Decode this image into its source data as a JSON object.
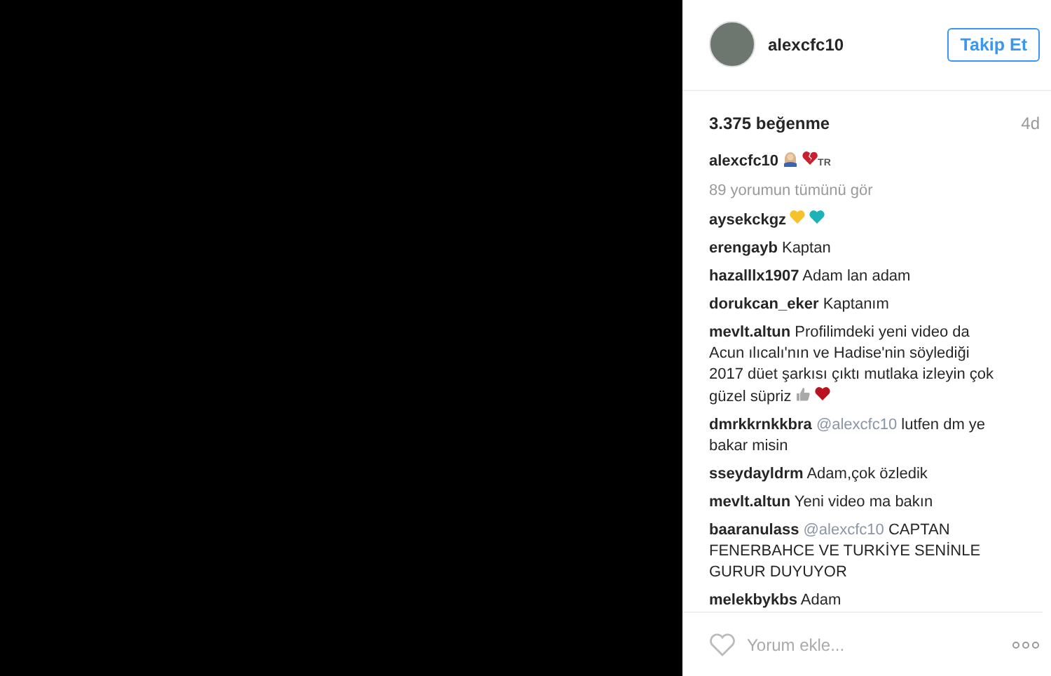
{
  "post": {
    "username": "alexcfc10",
    "follow_button": "Takip Et",
    "likes": "3.375 beğenme",
    "time": "4d"
  },
  "caption": {
    "username": "alexcfc10",
    "emojis": [
      {
        "kind": "person"
      },
      {
        "kind": "broken-heart",
        "color": "#c8202f"
      }
    ],
    "tag": "TR"
  },
  "view_all": "89 yorumun tümünü gör",
  "comments": [
    {
      "username": "aysekckgz",
      "emojis": [
        {
          "kind": "heart",
          "color": "#f6c12a"
        },
        {
          "kind": "heart",
          "color": "#1bb3b8"
        }
      ]
    },
    {
      "username": "erengayb",
      "text": "Kaptan"
    },
    {
      "username": "hazalllx1907",
      "text": "Adam lan adam"
    },
    {
      "username": "dorukcan_eker",
      "text": "Kaptanım"
    },
    {
      "username": "mevlt.altun",
      "text": "Profilimdeki yeni video da Acun ılıcalı'nın ve Hadise'nin söylediği 2017 düet şarkısı çıktı mutlaka izleyin çok güzel süpriz",
      "emojis": [
        {
          "kind": "thumbs-up"
        },
        {
          "kind": "heart",
          "color": "#b8141f"
        }
      ]
    },
    {
      "username": "dmrkkrnkkbra",
      "mention": "@alexcfc10",
      "text": "lutfen dm ye bakar misin"
    },
    {
      "username": "sseydayldrm",
      "text": "Adam,çok özledik"
    },
    {
      "username": "mevlt.altun",
      "text": "Yeni video ma bakın"
    },
    {
      "username": "baaranulass",
      "mention": "@alexcfc10",
      "text": "CAPTAN FENERBAHCE VE TURKİYE SENİNLE GURUR DUYUYOR"
    },
    {
      "username": "melekbykbs",
      "text": "Adam"
    }
  ],
  "comment_field": {
    "placeholder": "Yorum ekle..."
  }
}
